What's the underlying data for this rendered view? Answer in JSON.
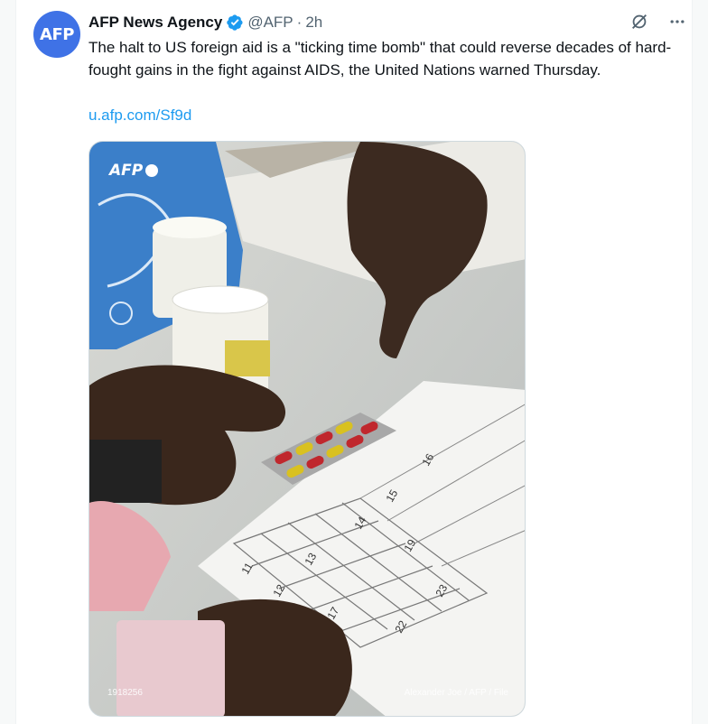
{
  "tweet": {
    "avatar_text": "AFP",
    "display_name": "AFP News Agency",
    "handle": "@AFP",
    "separator": "·",
    "time": "2h",
    "text": "The halt to US foreign aid is a \"ticking time bomb\" that could reverse decades of hard-fought gains in the fight against AIDS, the United Nations warned Thursday.",
    "link": "u.afp.com/Sf9d",
    "accent_color": "#1d9bf0",
    "verified_color": "#1d9bf0"
  },
  "actions": {
    "grok_icon": "grok-icon",
    "more_icon": "more-icon"
  },
  "media": {
    "logo_text": "AFP",
    "photo_id": "1918256",
    "credit": "Alexander Joe / AFP / File",
    "calendar_numbers": [
      "11",
      "12",
      "13",
      "14",
      "15",
      "16",
      "17",
      "19",
      "22",
      "23"
    ]
  }
}
